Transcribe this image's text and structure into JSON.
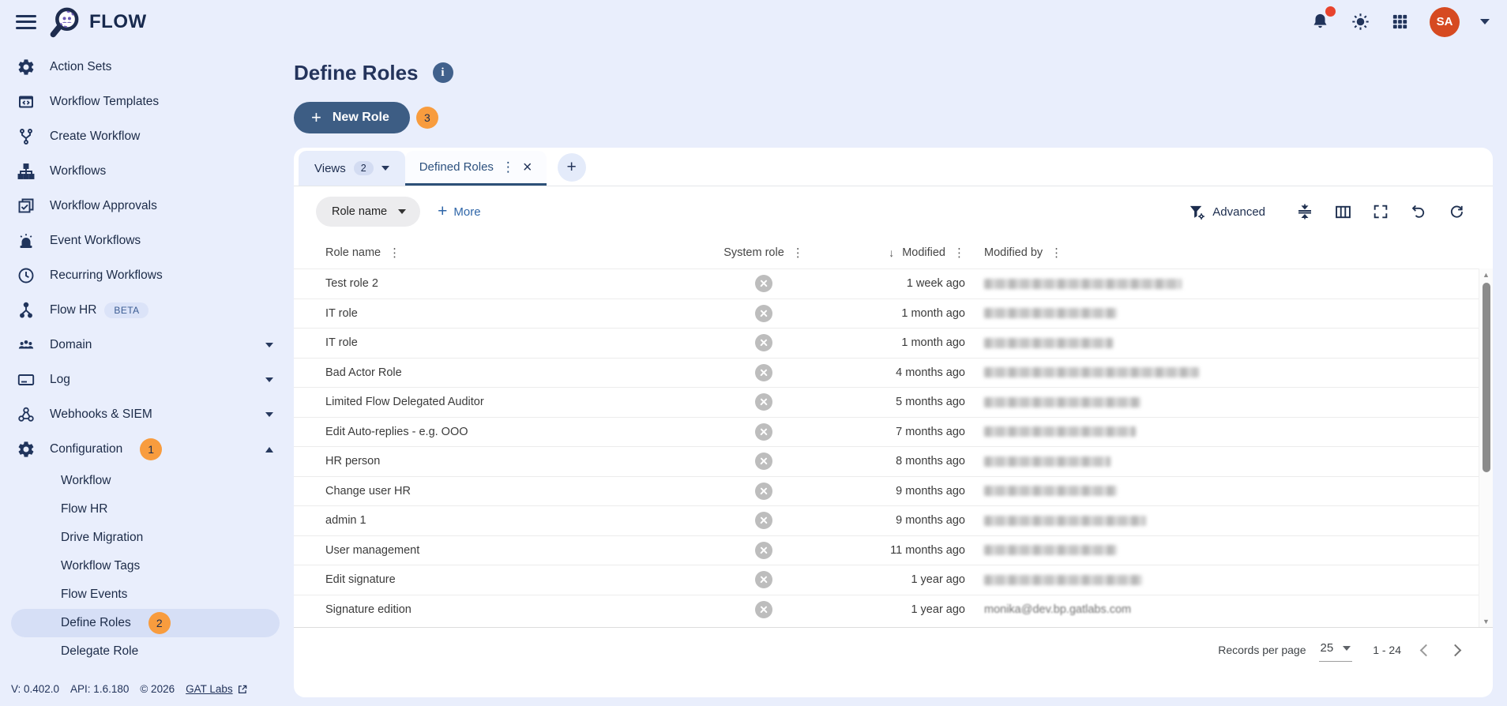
{
  "colors": {
    "background": "#e9eefc",
    "navy": "#20335a",
    "steel_button": "#3d5d84",
    "orange_badge": "#f89c3e",
    "notification_red": "#e8432d",
    "avatar_orange": "#d64a21",
    "selected_pill": "#d6dff6",
    "link_blue": "#2f66a8",
    "tab_active_blue": "#2d5078",
    "redacted_gray": "#bdbdbd"
  },
  "header": {
    "app_name": "FLOW",
    "avatar_initials": "SA",
    "icons": [
      "hamburger-menu-icon",
      "flow-logo-magnifier",
      "bell-icon",
      "theme-sun-icon",
      "apps-grid-icon",
      "chevron-down-icon"
    ],
    "has_notification_dot": true
  },
  "sidebar": {
    "items": [
      {
        "label": "Action Sets",
        "icon": "action-sets"
      },
      {
        "label": "Workflow Templates",
        "icon": "workflow-templates"
      },
      {
        "label": "Create Workflow",
        "icon": "create-workflow"
      },
      {
        "label": "Workflows",
        "icon": "workflows"
      },
      {
        "label": "Workflow Approvals",
        "icon": "workflow-approvals"
      },
      {
        "label": "Event Workflows",
        "icon": "event-workflows"
      },
      {
        "label": "Recurring Workflows",
        "icon": "recurring-workflows"
      },
      {
        "label": "Flow HR",
        "icon": "flow-hr",
        "badge_text": "BETA"
      },
      {
        "label": "Domain",
        "icon": "domain",
        "expandable": true
      },
      {
        "label": "Log",
        "icon": "log",
        "expandable": true
      },
      {
        "label": "Webhooks & SIEM",
        "icon": "webhooks",
        "expandable": true
      },
      {
        "label": "Configuration",
        "icon": "configuration",
        "badge_count": "1",
        "expanded": true
      }
    ],
    "config_subitems": [
      {
        "label": "Workflow"
      },
      {
        "label": "Flow HR"
      },
      {
        "label": "Drive Migration"
      },
      {
        "label": "Workflow Tags"
      },
      {
        "label": "Flow Events"
      },
      {
        "label": "Define Roles",
        "badge_count": "2",
        "selected": true
      },
      {
        "label": "Delegate Role"
      }
    ],
    "footer": {
      "version": "V: 0.402.0",
      "api": "API: 1.6.180",
      "copyright": "© 2026",
      "link_label": "GAT Labs"
    }
  },
  "main": {
    "title": "Define Roles",
    "new_role": {
      "label": "New Role",
      "badge": "3"
    },
    "tabs": {
      "views_label": "Views",
      "views_count": "2",
      "active_label": "Defined Roles",
      "close_glyph": "×",
      "kebab_glyph": "⋮",
      "add_glyph": "+"
    },
    "toolbar": {
      "filter_chip": "Role name",
      "more_label": "More",
      "advanced_label": "Advanced",
      "icons": [
        "filter-gear-icon",
        "row-density-icon",
        "columns-icon",
        "fullscreen-icon",
        "undo-icon",
        "refresh-icon"
      ]
    },
    "table": {
      "columns": [
        {
          "label": "Role name"
        },
        {
          "label": "System role"
        },
        {
          "label": "Modified",
          "sort_indicator": "↓"
        },
        {
          "label": "Modified by"
        }
      ],
      "kebab_glyph": "⋮",
      "system_role_icon": "x-circle-icon",
      "rows": [
        {
          "role_name": "Test role 2",
          "modified": "1 week ago",
          "modified_by_redacted": true,
          "redacted_width": 250
        },
        {
          "role_name": "IT role",
          "modified": "1 month ago",
          "modified_by_redacted": true,
          "redacted_width": 168
        },
        {
          "role_name": "IT role",
          "modified": "1 month ago",
          "modified_by_redacted": true,
          "redacted_width": 163
        },
        {
          "role_name": "Bad Actor Role",
          "modified": "4 months ago",
          "modified_by_redacted": true,
          "redacted_width": 272
        },
        {
          "role_name": "Limited Flow Delegated Auditor",
          "modified": "5 months ago",
          "modified_by_redacted": true,
          "redacted_width": 198
        },
        {
          "role_name": "Edit Auto-replies - e.g. OOO",
          "modified": "7 months ago",
          "modified_by_redacted": true,
          "redacted_width": 192
        },
        {
          "role_name": "HR person",
          "modified": "8 months ago",
          "modified_by_redacted": true,
          "redacted_width": 160
        },
        {
          "role_name": "Change user HR",
          "modified": "9 months ago",
          "modified_by_redacted": true,
          "redacted_width": 168
        },
        {
          "role_name": "admin 1",
          "modified": "9 months ago",
          "modified_by_redacted": true,
          "redacted_width": 205
        },
        {
          "role_name": "User management",
          "modified": "11 months ago",
          "modified_by_redacted": true,
          "redacted_width": 168
        },
        {
          "role_name": "Edit signature",
          "modified": "1 year ago",
          "modified_by_redacted": true,
          "redacted_width": 200
        },
        {
          "role_name": "Signature edition",
          "modified": "1 year ago",
          "modified_by_redacted": false,
          "modified_by": "monika@dev.bp.gatlabs.com"
        }
      ]
    },
    "pagination": {
      "records_per_page_label": "Records per page",
      "records_per_page_value": "25",
      "range": "1 - 24"
    }
  }
}
